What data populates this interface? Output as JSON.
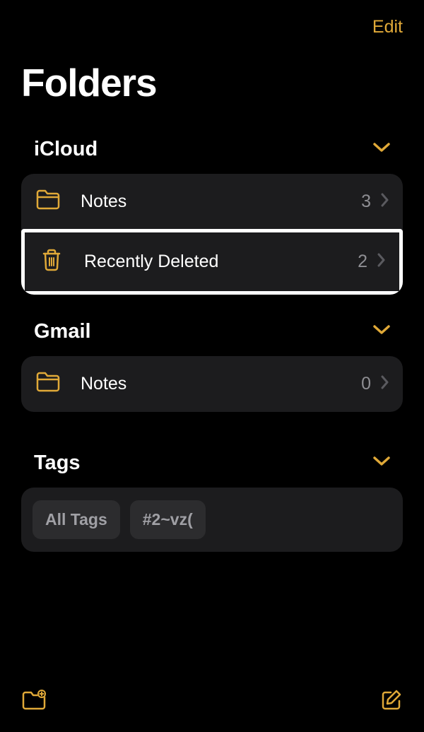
{
  "topBar": {
    "editLabel": "Edit"
  },
  "title": "Folders",
  "colors": {
    "accent": "#e0a938",
    "background": "#000000",
    "cardBackground": "#1c1c1e",
    "chipBackground": "#2c2c2e",
    "secondaryText": "#8e8e93"
  },
  "sections": [
    {
      "title": "iCloud",
      "folders": [
        {
          "icon": "folder-icon",
          "label": "Notes",
          "count": "3"
        },
        {
          "icon": "trash-icon",
          "label": "Recently Deleted",
          "count": "2",
          "highlighted": true
        }
      ]
    },
    {
      "title": "Gmail",
      "folders": [
        {
          "icon": "folder-icon",
          "label": "Notes",
          "count": "0"
        }
      ]
    }
  ],
  "tags": {
    "title": "Tags",
    "items": [
      "All Tags",
      "#2~vz("
    ]
  },
  "bottomBar": {
    "newFolderIcon": "new-folder-icon",
    "composeIcon": "compose-icon"
  }
}
